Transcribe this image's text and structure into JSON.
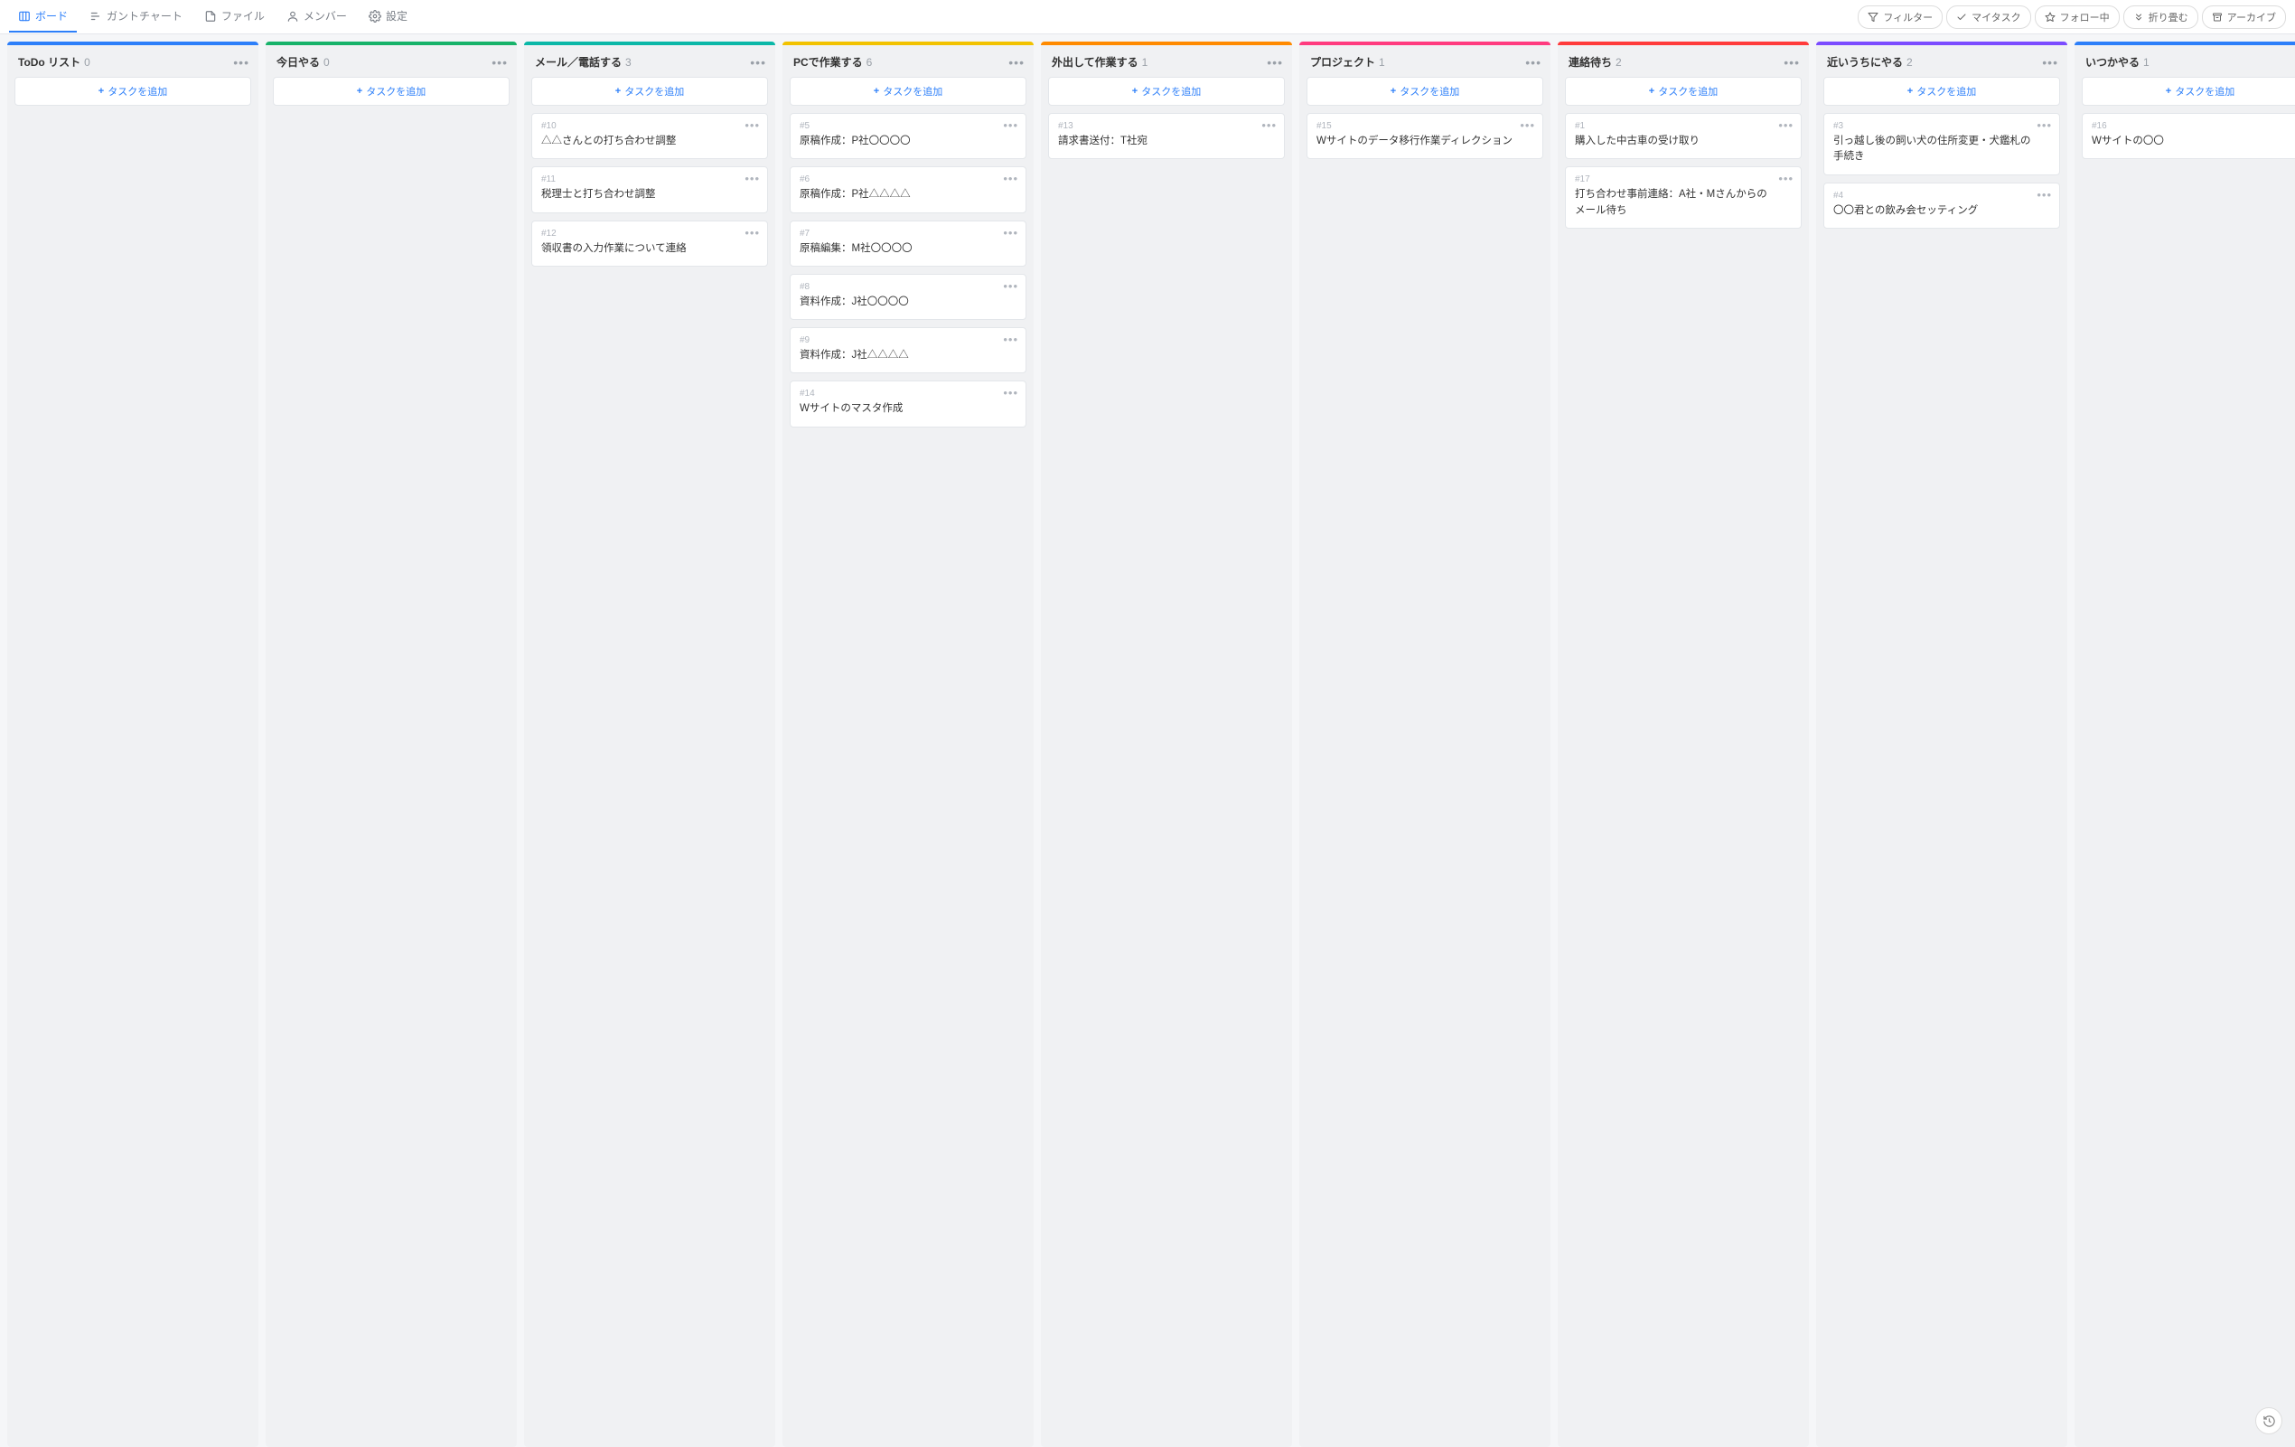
{
  "nav": {
    "tabs": [
      {
        "icon": "board",
        "label": "ボード",
        "active": true
      },
      {
        "icon": "gantt",
        "label": "ガントチャート"
      },
      {
        "icon": "file",
        "label": "ファイル"
      },
      {
        "icon": "member",
        "label": "メンバー"
      },
      {
        "icon": "gear",
        "label": "設定"
      }
    ],
    "actions": [
      {
        "icon": "filter",
        "label": "フィルター"
      },
      {
        "icon": "check",
        "label": "マイタスク"
      },
      {
        "icon": "star",
        "label": "フォロー中"
      },
      {
        "icon": "collapse",
        "label": "折り畳む"
      },
      {
        "icon": "archive",
        "label": "アーカイブ"
      }
    ]
  },
  "add_task_label": "タスクを追加",
  "columns": [
    {
      "title": "ToDo リスト",
      "count": 0,
      "color": "#2d7ff9",
      "cards": []
    },
    {
      "title": "今日やる",
      "count": 0,
      "color": "#17b36a",
      "cards": []
    },
    {
      "title": "メール／電話する",
      "count": 3,
      "color": "#0bb8a8",
      "cards": [
        {
          "id": "#10",
          "title": "△△さんとの打ち合わせ調整"
        },
        {
          "id": "#11",
          "title": "税理士と打ち合わせ調整"
        },
        {
          "id": "#12",
          "title": "領収書の入力作業について連絡"
        }
      ]
    },
    {
      "title": "PCで作業する",
      "count": 6,
      "color": "#f2c200",
      "cards": [
        {
          "id": "#5",
          "title": "原稿作成：P社〇〇〇〇"
        },
        {
          "id": "#6",
          "title": "原稿作成：P社△△△△"
        },
        {
          "id": "#7",
          "title": "原稿編集：M社〇〇〇〇"
        },
        {
          "id": "#8",
          "title": "資料作成：J社〇〇〇〇"
        },
        {
          "id": "#9",
          "title": "資料作成：J社△△△△"
        },
        {
          "id": "#14",
          "title": "Wサイトのマスタ作成"
        }
      ]
    },
    {
      "title": "外出して作業する",
      "count": 1,
      "color": "#ff8a00",
      "cards": [
        {
          "id": "#13",
          "title": "請求書送付：T社宛"
        }
      ]
    },
    {
      "title": "プロジェクト",
      "count": 1,
      "color": "#ff3b7f",
      "cards": [
        {
          "id": "#15",
          "title": "Wサイトのデータ移行作業ディレクション"
        }
      ]
    },
    {
      "title": "連絡待ち",
      "count": 2,
      "color": "#ff3b3b",
      "cards": [
        {
          "id": "#1",
          "title": "購入した中古車の受け取り"
        },
        {
          "id": "#17",
          "title": "打ち合わせ事前連絡：A社・Mさんからのメール待ち"
        }
      ]
    },
    {
      "title": "近いうちにやる",
      "count": 2,
      "color": "#7b4cff",
      "cards": [
        {
          "id": "#3",
          "title": "引っ越し後の飼い犬の住所変更・犬鑑札の手続き"
        },
        {
          "id": "#4",
          "title": "〇〇君との飲み会セッティング"
        }
      ]
    },
    {
      "title": "いつかやる",
      "count": 1,
      "color": "#2d7ff9",
      "cards": [
        {
          "id": "#16",
          "title": "Wサイトの〇〇"
        }
      ]
    }
  ]
}
